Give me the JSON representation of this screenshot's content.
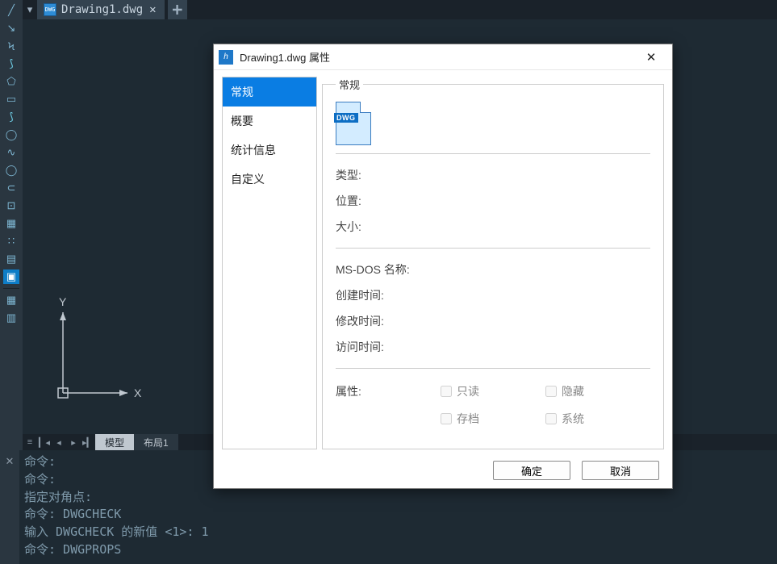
{
  "tab": {
    "filename": "Drawing1.dwg",
    "icon_text": "DWG"
  },
  "ucs": {
    "x_label": "X",
    "y_label": "Y"
  },
  "layout_tabs": {
    "model": "模型",
    "layout1": "布局1"
  },
  "command_log": {
    "l1": "命令:",
    "l2": "命令:",
    "l3": "指定对角点:",
    "l4": "命令: DWGCHECK",
    "l5": "输入 DWGCHECK 的新值 <1>: 1",
    "l6": "命令: DWGPROPS"
  },
  "dialog": {
    "title": "Drawing1.dwg 属性",
    "nav": {
      "general": "常规",
      "summary": "概要",
      "stats": "统计信息",
      "custom": "自定义"
    },
    "group_label": "常规",
    "icon_badge": "DWG",
    "fields": {
      "type": "类型:",
      "location": "位置:",
      "size": "大小:",
      "msdos": "MS-DOS 名称:",
      "created": "创建时间:",
      "modified": "修改时间:",
      "accessed": "访问时间:",
      "attributes": "属性:"
    },
    "checks": {
      "readonly": "只读",
      "hidden": "隐藏",
      "archive": "存档",
      "system": "系统"
    },
    "buttons": {
      "ok": "确定",
      "cancel": "取消"
    }
  }
}
